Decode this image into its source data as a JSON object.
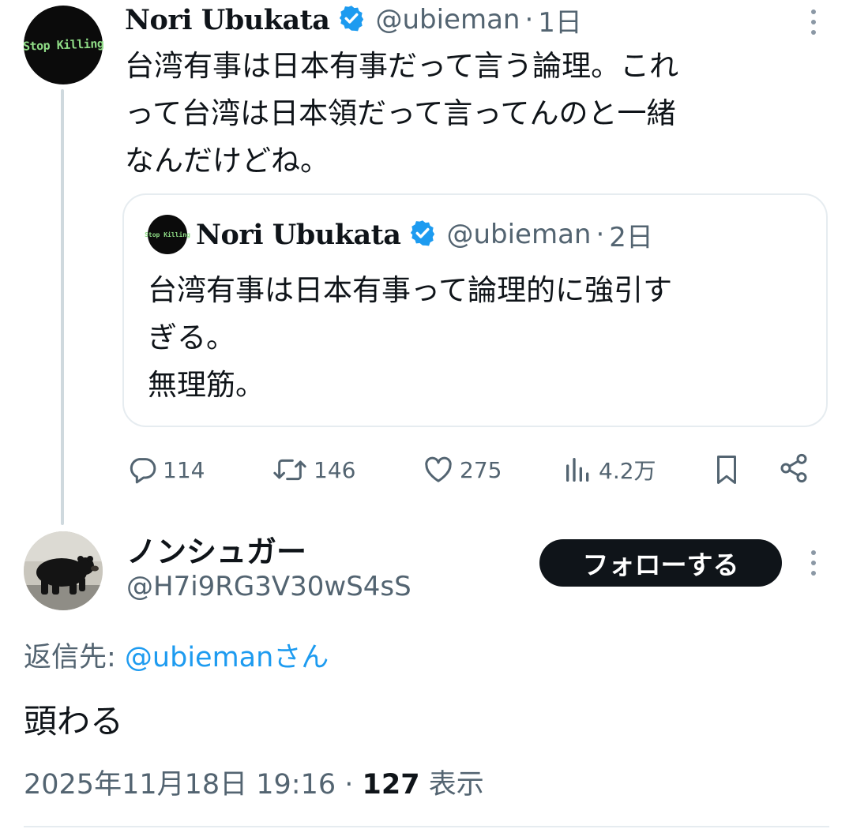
{
  "tweet": {
    "author_name": "Nori Ubukata",
    "handle": "@ubieman",
    "separator": "·",
    "time": "1日",
    "avatar_text": "Stop Killing",
    "text_lines": [
      "台湾有事は日本有事だって言う論理。これ",
      "って台湾は日本領だって言ってんのと一緒",
      "なんだけどね。"
    ],
    "more_icon": "more-vertical-icon",
    "verified_icon": "verified-badge-icon"
  },
  "quote": {
    "author_name": "Nori Ubukata",
    "handle": "@ubieman",
    "separator": "·",
    "time": "2日",
    "avatar_text": "Stop Killing",
    "text_lines": [
      "台湾有事は日本有事って論理的に強引す",
      "ぎる。",
      "無理筋。"
    ]
  },
  "actions": {
    "replies": "114",
    "retweets": "146",
    "likes": "275",
    "views": "4.2万",
    "icons": [
      "reply-icon",
      "retweet-icon",
      "like-icon",
      "views-icon",
      "bookmark-icon",
      "share-icon"
    ]
  },
  "reply": {
    "author_name": "ノンシュガー",
    "handle": "@H7i9RG3V30wS4sS",
    "follow_label": "フォローする",
    "replying_to_prefix": "返信先: ",
    "replying_to_handle": "@ubiemanさん",
    "text": "頭わる",
    "date": "2025年11月18日 19:16",
    "separator": " · ",
    "views_count": "127",
    "views_label": " 表示"
  },
  "colors": {
    "text": "#0f1419",
    "muted": "#536471",
    "link": "#1d9bf0",
    "border": "#e6ecf0",
    "verified": "#1d9bf0",
    "avatar_text": "#8fdc86"
  }
}
